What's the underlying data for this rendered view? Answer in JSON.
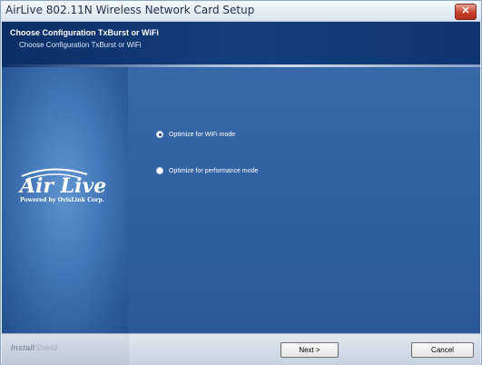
{
  "window": {
    "title": "AirLive 802.11N Wireless Network Card Setup",
    "close_glyph": "✕"
  },
  "header": {
    "title": "Choose Configuration TxBurst or WiFi",
    "subtitle": "Choose Configuration TxBurst or WiFi"
  },
  "logo": {
    "brand": "Air Live",
    "tagline": "Powered by OvisLink Corp."
  },
  "options": [
    {
      "label": "Optimize for WiFi mode",
      "selected": true
    },
    {
      "label": "Optimize for performance mode",
      "selected": false
    }
  ],
  "footer": {
    "installshield_a": "Install",
    "installshield_b": "Shield",
    "next_label": "Next >",
    "cancel_label": "Cancel"
  },
  "icons": {
    "close": "close-icon",
    "radio": "radio-button-icon"
  },
  "colors": {
    "header_bg": "#133f7f",
    "main_bg": "#2f5f9f",
    "close_red": "#c8402b"
  }
}
